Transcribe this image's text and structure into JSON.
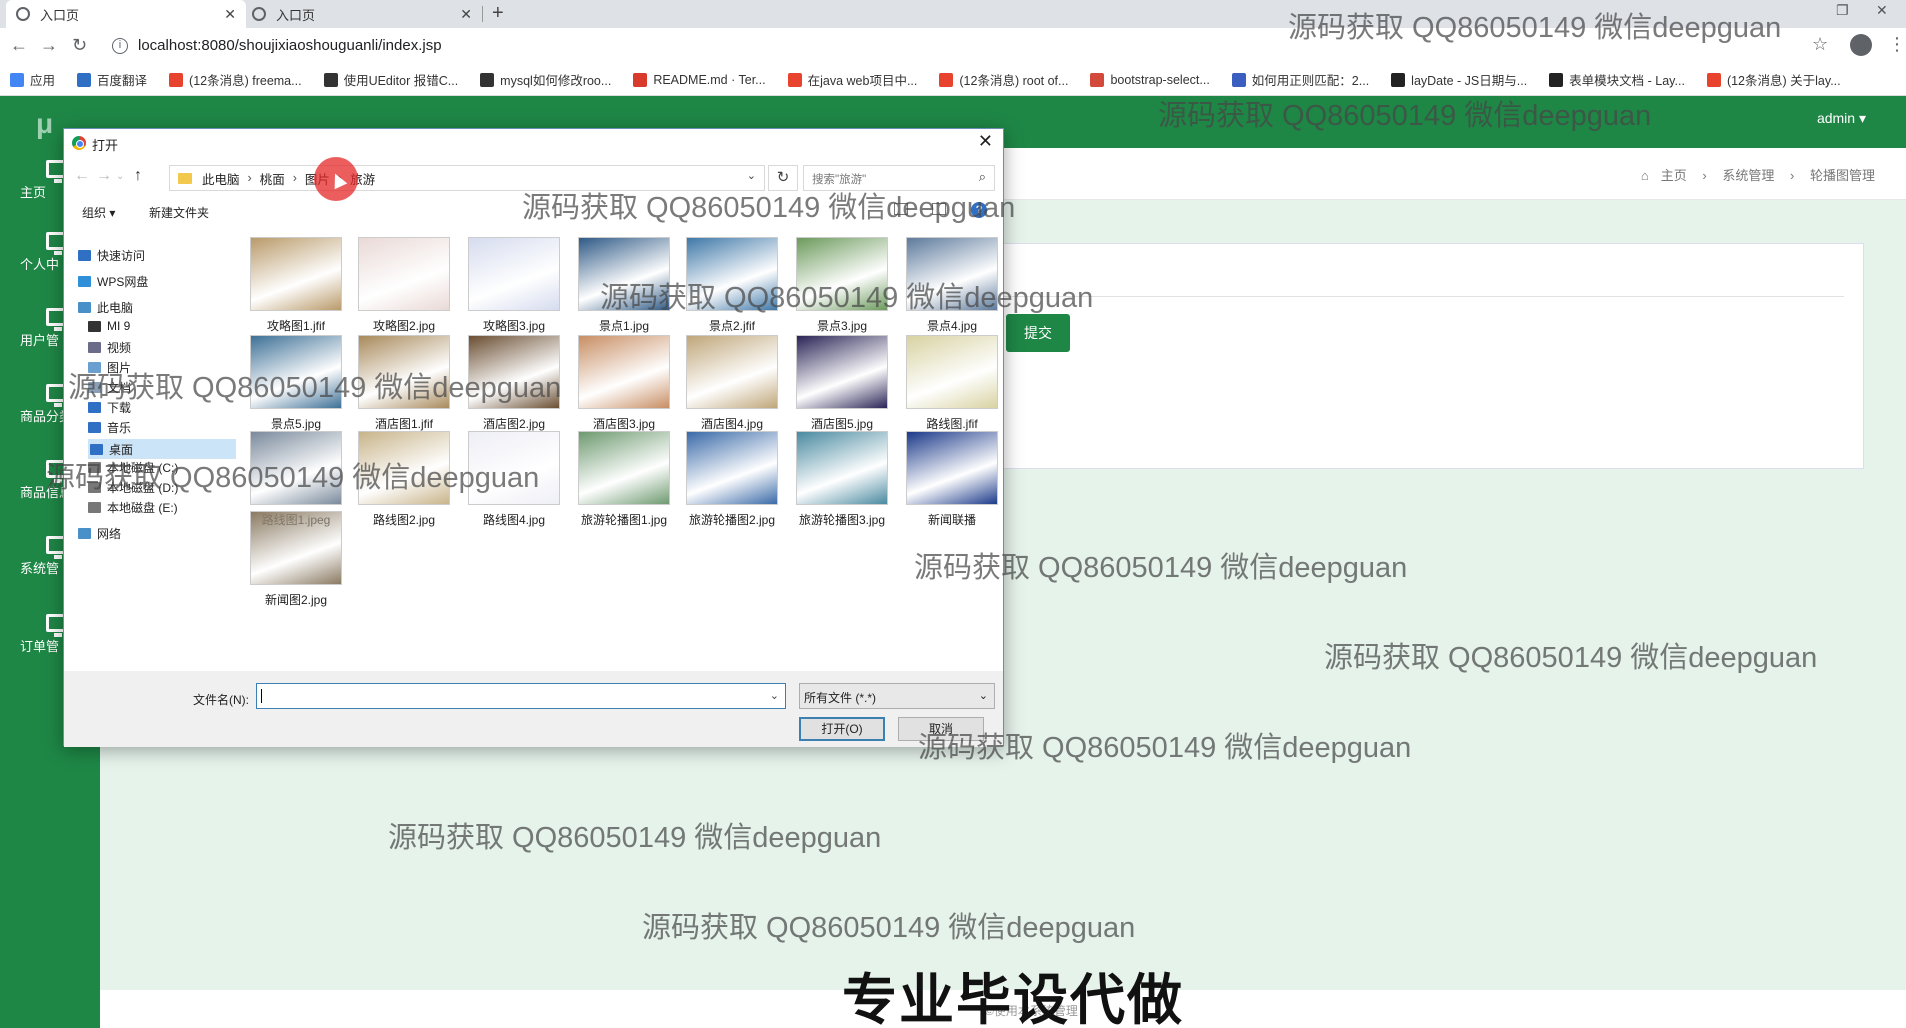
{
  "browser": {
    "tabs": [
      {
        "label": "入口页"
      },
      {
        "label": "入口页"
      }
    ],
    "url": "localhost:8080/shoujixiaoshouguanli/index.jsp",
    "bookmarks": [
      {
        "label": "应用",
        "color": "#4285f4"
      },
      {
        "label": "百度翻译",
        "color": "#2f6fc4"
      },
      {
        "label": "(12条消息) freema...",
        "color": "#e8432e"
      },
      {
        "label": "使用UEditor 报错C...",
        "color": "#333333"
      },
      {
        "label": "mysql如何修改roo...",
        "color": "#333333"
      },
      {
        "label": "README.md · Ter...",
        "color": "#d83a2c"
      },
      {
        "label": "在java web项目中...",
        "color": "#e8432e"
      },
      {
        "label": "(12条消息) root of...",
        "color": "#e8432e"
      },
      {
        "label": "bootstrap-select...",
        "color": "#d44a3a"
      },
      {
        "label": "如何用正则匹配：2...",
        "color": "#3b5fc0"
      },
      {
        "label": "layDate - JS日期与...",
        "color": "#222222"
      },
      {
        "label": "表单模块文档 - Lay...",
        "color": "#222222"
      },
      {
        "label": "(12条消息) 关于lay...",
        "color": "#e8432e"
      }
    ]
  },
  "app": {
    "logo": "μ",
    "user": "admin ▾",
    "sidebar": [
      {
        "label": "主页"
      },
      {
        "label": "个人中"
      },
      {
        "label": "用户管"
      },
      {
        "label": "商品分类"
      },
      {
        "label": "商品信息"
      },
      {
        "label": "系统管"
      },
      {
        "label": "订单管"
      }
    ],
    "breadcrumb": [
      "主页",
      "系统管理",
      "轮播图管理"
    ],
    "submit_label": "提交",
    "footer_text": "©使用本系统管理"
  },
  "dialog": {
    "title": "打开",
    "path": [
      "此电脑",
      "桃面",
      "图片",
      "旅游"
    ],
    "search_placeholder": "搜索\"旅游\"",
    "organize_label": "组织 ▾",
    "new_folder_label": "新建文件夹",
    "tree": [
      {
        "label": "快速访问",
        "color": "#2f6fc4"
      },
      {
        "label": "WPS网盘",
        "color": "#2f8fd8"
      },
      {
        "label": "此电脑",
        "color": "#4a90c8"
      },
      {
        "label": "MI 9",
        "color": "#333333"
      },
      {
        "label": "视频",
        "color": "#6b6b8a"
      },
      {
        "label": "图片",
        "color": "#6aa0d0"
      },
      {
        "label": "文档",
        "color": "#8aa0b8"
      },
      {
        "label": "下载",
        "color": "#2f6fc4"
      },
      {
        "label": "音乐",
        "color": "#2f6fc4"
      },
      {
        "label": "桌面",
        "color": "#2f6fc4"
      },
      {
        "label": "本地磁盘 (C:)",
        "color": "#777777"
      },
      {
        "label": "本地磁盘 (D:)",
        "color": "#777777"
      },
      {
        "label": "本地磁盘 (E:)",
        "color": "#777777"
      },
      {
        "label": "网络",
        "color": "#4a90c8"
      }
    ],
    "files": [
      {
        "name": "攻略图1.jfif",
        "color": "#b99a6a"
      },
      {
        "name": "攻略图2.jpg",
        "color": "#e9d9d6"
      },
      {
        "name": "攻略图3.jpg",
        "color": "#d6dcef"
      },
      {
        "name": "景点1.jpg",
        "color": "#2f5a86"
      },
      {
        "name": "景点2.jfif",
        "color": "#3f78a8"
      },
      {
        "name": "景点3.jpg",
        "color": "#6c9a5c"
      },
      {
        "name": "景点4.jpg",
        "color": "#5d7a9c"
      },
      {
        "name": "景点5.jpg",
        "color": "#3d7096"
      },
      {
        "name": "酒店图1.jfif",
        "color": "#a88a5c"
      },
      {
        "name": "酒店图2.jpg",
        "color": "#6a4e32"
      },
      {
        "name": "酒店图3.jpg",
        "color": "#c88e64"
      },
      {
        "name": "酒店图4.jpg",
        "color": "#bfa67a"
      },
      {
        "name": "酒店图5.jpg",
        "color": "#2a2456"
      },
      {
        "name": "路线图.jfif",
        "color": "#d8d2a2"
      },
      {
        "name": "路线图1.jpeg",
        "color": "#7a8a9c"
      },
      {
        "name": "路线图2.jpg",
        "color": "#c8b48a"
      },
      {
        "name": "路线图4.jpg",
        "color": "#eeeef6"
      },
      {
        "name": "旅游轮播图1.jpg",
        "color": "#6e9a70"
      },
      {
        "name": "旅游轮播图2.jpg",
        "color": "#3a6aa8"
      },
      {
        "name": "旅游轮播图3.jpg",
        "color": "#4a8aa0"
      },
      {
        "name": "新闻联播",
        "color": "#1c3a8a"
      },
      {
        "name": "新闻图2.jpg",
        "color": "#8a7a62"
      }
    ],
    "filename_label": "文件名(N):",
    "filetype": "所有文件 (*.*)",
    "open_label": "打开(O)",
    "cancel_label": "取消"
  },
  "watermark": "源码获取 QQ86050149 微信deepguan",
  "banner": "专业毕设代做"
}
